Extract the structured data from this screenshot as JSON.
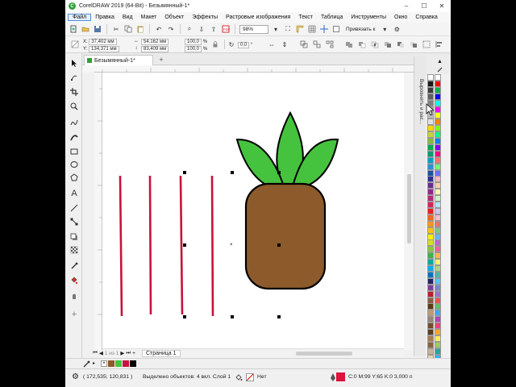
{
  "window": {
    "title": "CorelDRAW 2019 (64-Bit) - Безымянный-1*",
    "logo_letter": "C",
    "minimize": "–",
    "maximize": "☐",
    "close": "✕"
  },
  "menu": {
    "items": [
      "Файл",
      "Правка",
      "Вид",
      "Макет",
      "Объект",
      "Эффекты",
      "Растровые изображения",
      "Текст",
      "Таблица",
      "Инструменты",
      "Окно",
      "Справка"
    ]
  },
  "toolbar": {
    "zoom_value": "98%",
    "snap_label": "Привязать к"
  },
  "properties": {
    "x_label": "X:",
    "x_value": "37,402 мм",
    "y_label": "Y:",
    "y_value": "134,371 мм",
    "width_value": "54,162 мм",
    "height_value": "83,409 мм",
    "scale_x": "100,0",
    "scale_y": "100,0",
    "percent": "%",
    "rotation_value": "0,0",
    "rotation_unit": "°"
  },
  "document": {
    "tab_title": "Безымянный-1*",
    "page_tab": "Страница 1",
    "page_counter": "1 из 1"
  },
  "docker": {
    "label": "Выровнять и рас..."
  },
  "status": {
    "coordinates": "( 172,535; 120,831 )",
    "selection": "Выделено объектов: 4 вкл. Слой 1",
    "fill_label": "Нет",
    "stroke_info": "C:0 M:99 Y:65 K:0  3,000 п"
  },
  "colors": {
    "leaf_green": "#46c33e",
    "pineapple_brown": "#8c5a2b",
    "stroke_red": "#c8123c",
    "outline_black": "#000000",
    "status_fill": "#dc143c"
  },
  "palette": {
    "columns": [
      [
        "#ffffff",
        "#1a1a1a",
        "#3d3d3d",
        "#606060",
        "#808080",
        "#a0a0a0",
        "#c0c0c0",
        "#e0e0e0",
        "#ffd700",
        "#c5d43f",
        "#80bf40",
        "#00a84f",
        "#009b77",
        "#00a0c6",
        "#2a8fd6",
        "#1f4fa1",
        "#2e3192",
        "#662d91",
        "#92278f",
        "#b5287e",
        "#d6235f",
        "#ed1c24",
        "#f26522",
        "#f7941d",
        "#ffc20e",
        "#fff200",
        "#d7df23",
        "#8dc63f",
        "#39b54a",
        "#00a99d",
        "#00aeef",
        "#0072bc",
        "#262262",
        "#7f3f98",
        "#be1e2d",
        "#8b5e3c",
        "#603913",
        "#c49a6c",
        "#998675",
        "#754c29",
        "#5b3d1f",
        "#a67c52",
        "#8b6239",
        "#c7b299",
        "#e6d3b3"
      ],
      [
        "#ffffff",
        "#ff0000",
        "#00b050",
        "#0000ff",
        "#00ffff",
        "#ff00ff",
        "#ffff00",
        "#ff8000",
        "#80ff00",
        "#00ff80",
        "#0080ff",
        "#8000ff",
        "#ff0080",
        "#ff6f6f",
        "#6fff6f",
        "#6f6fff",
        "#ffb6c1",
        "#ffd1a4",
        "#fffab0",
        "#c8f7c5",
        "#b3e5fc",
        "#d1c4e9",
        "#f8bbd0",
        "#e57373",
        "#81c784",
        "#64b5f6",
        "#ba68c8",
        "#f06292",
        "#ffb74d",
        "#fff176",
        "#aed581",
        "#4db6ac",
        "#4fc3f7",
        "#7986cb",
        "#9575cd",
        "#ef5350",
        "#66bb6a",
        "#42a5f5",
        "#ab47bc",
        "#ec407a",
        "#ffa726",
        "#ffee58",
        "#9ccc65",
        "#26a69a",
        "#29b6f6"
      ]
    ]
  },
  "docstatus": {
    "none_swatch": "×"
  }
}
